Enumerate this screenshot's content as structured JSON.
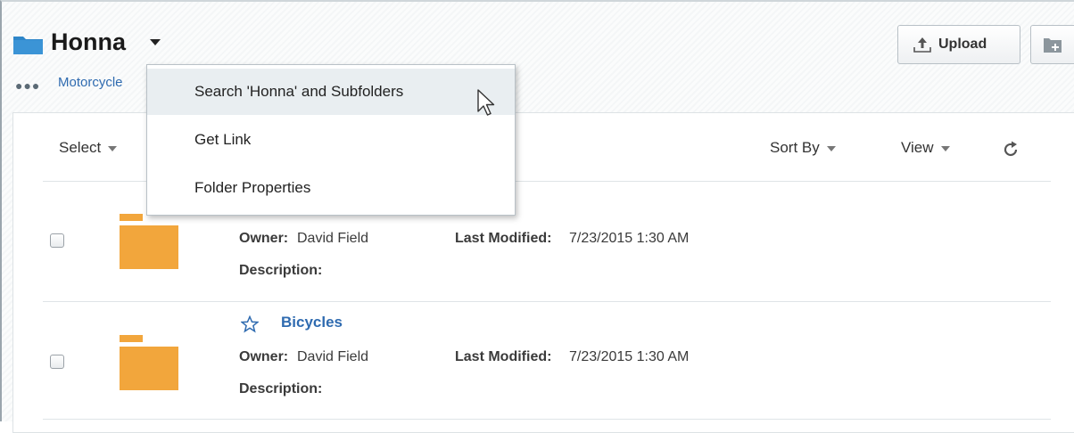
{
  "header": {
    "folder_title": "Honna",
    "breadcrumb_dots": "●●●",
    "breadcrumb_link": "Motorcycle"
  },
  "actions": {
    "upload_label": "Upload"
  },
  "toolbar": {
    "select_label": "Select",
    "sort_label": "Sort By",
    "view_label": "View"
  },
  "menu": {
    "items": [
      "Search 'Honna' and Subfolders",
      "Get Link",
      "Folder Properties"
    ]
  },
  "rows": [
    {
      "name": "",
      "owner_label": "Owner:",
      "owner": "David Field",
      "modified_label": "Last Modified:",
      "modified": "7/23/2015 1:30 AM",
      "description_label": "Description:"
    },
    {
      "name": "Bicycles",
      "owner_label": "Owner:",
      "owner": "David Field",
      "modified_label": "Last Modified:",
      "modified": "7/23/2015 1:30 AM",
      "description_label": "Description:"
    }
  ],
  "colors": {
    "accent": "#2f6bb0",
    "folder": "#f2a63c"
  }
}
